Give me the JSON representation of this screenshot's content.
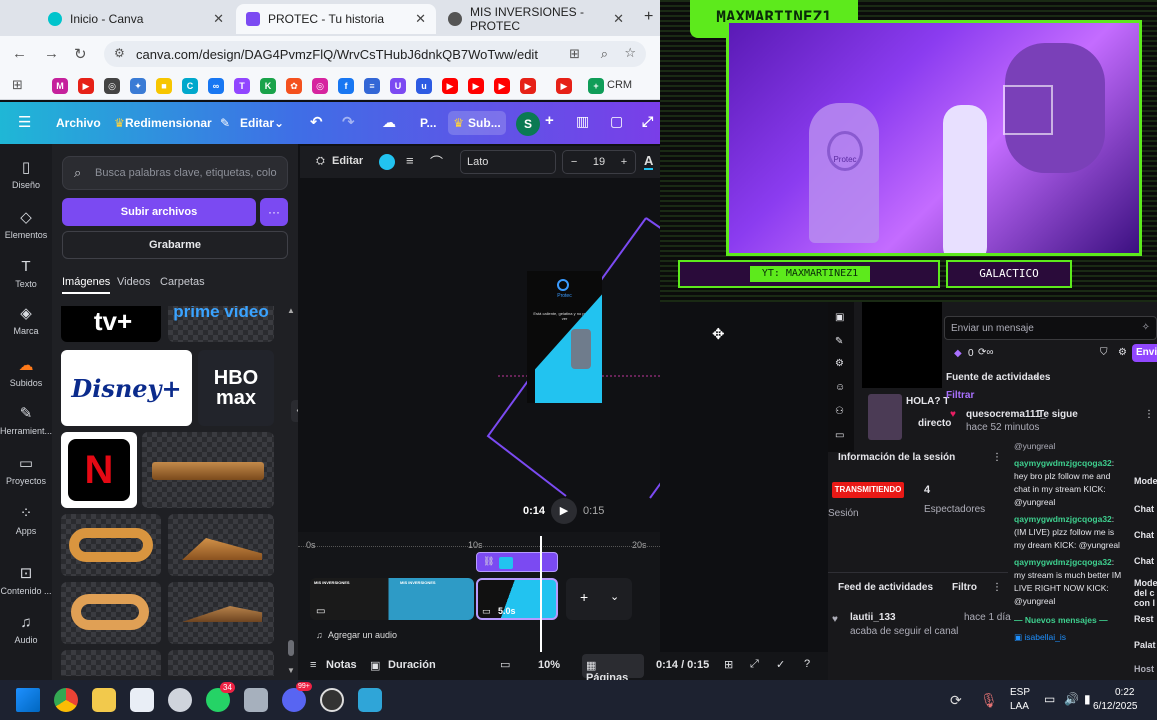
{
  "browser": {
    "tabs": [
      {
        "title": "Inicio - Canva",
        "active": false
      },
      {
        "title": "PROTEC - Tu historia",
        "active": true
      },
      {
        "title": "MIS INVERSIONES - PROTEC",
        "active": false
      }
    ],
    "new_tab": "+",
    "url": "canva.com/design/DAG4PvmzFlQ/WrvCsTHubJ6dnkQB7WoTww/edit",
    "bookmark_crm": "CRM"
  },
  "canva": {
    "header": {
      "archivo": "Archivo",
      "redimensionar": "Redimensionar",
      "editar": "Editar",
      "p": "P...",
      "sub": "Sub...",
      "avatar": "S"
    },
    "rail": [
      "Diseño",
      "Elementos",
      "Texto",
      "Marca",
      "Subidos",
      "Herramient...",
      "Proyectos",
      "Apps",
      "Contenido ...",
      "Audio"
    ],
    "panel": {
      "search_placeholder": "Busca palabras clave, etiquetas, colo",
      "upload": "Subir archivos",
      "more": "···",
      "record": "Grabarme",
      "tabs": [
        "Imágenes",
        "Videos",
        "Carpetas"
      ],
      "logos": {
        "tv": "tv+",
        "prime": "prime video",
        "disney": "Disney+",
        "hbo1": "HBO",
        "hbo2": "max",
        "netflix": "N"
      }
    },
    "toolbar": {
      "editar": "Editar",
      "font": "Lato",
      "minus": "−",
      "size": "19",
      "plus": "+",
      "a": "A"
    },
    "playback": {
      "current": "0:14",
      "total": "0:15"
    },
    "timeline": {
      "t0": "0s",
      "t10": "10s",
      "t20": "20s",
      "clip_duration": "5.0s",
      "audio": "Agregar un audio",
      "clip1": "MIS INVERSIONES",
      "clip2": "MIS INVERSIONES"
    },
    "preview": {
      "brand": "Protec",
      "text": "Está caliente, gelatina y no pueden ver"
    },
    "bottom": {
      "notas": "Notas",
      "duracion": "Duración",
      "zoom": "10%",
      "paginas": "Páginas",
      "time": "0:14 / 0:15"
    }
  },
  "stream": {
    "streamer": "MAXMARTINEZ1",
    "yt": "YT: MAXMARTINEZ1",
    "galactico": "GALACTICO",
    "mic_brand": "Protec"
  },
  "twitch": {
    "chat_placeholder": "Enviar un mensaje",
    "send": "Envi",
    "points": "0",
    "activity_title": "Fuente de actividades",
    "filter": "Filtrar",
    "follow_user": "quesocrema111_",
    "follow_text": "Te sigue",
    "follow_time": "hace 52 minutos",
    "video_title": "HOLA? T",
    "video_sub": "directo",
    "session_title": "Información de la sesión",
    "live_badge": "TRANSMITIENDO",
    "live_count": "4",
    "sesion": "Sesión",
    "espectadores": "Espectadores",
    "feed_title": "Feed de actividades",
    "feed_filter": "Filtro",
    "feed_user": "lautii_133",
    "feed_text": "acaba de seguir el canal",
    "feed_time": "hace 1 día",
    "mention_top": "@yungreal",
    "chat": [
      {
        "user": "qaymygwdmzjgcqoga32",
        "text": ": hey bro plz follow me and chat in my stream KICK: @yungreal"
      },
      {
        "user": "qaymygwdmzjgcqoga32",
        "text": ": (IM LIVE) plzz follow me is my dream KICK: @yungreal"
      },
      {
        "user": "qaymygwdmzjgcqoga32",
        "text": ": my stream is much better IM LIVE RIGHT NOW KICK: @yungreal"
      }
    ],
    "new_messages": "Nuevos mensajes",
    "last_user": "isabellai_is",
    "right_col": [
      "Mode",
      "Chat",
      "Chat",
      "Chat",
      "Mode del c con l",
      "Rest",
      "Palat",
      "Host"
    ]
  },
  "taskbar": {
    "lang1": "ESP",
    "lang2": "LAA",
    "time": "0:22",
    "date": "6/12/2025",
    "badge": "34",
    "badge2": "99+"
  },
  "colors": {
    "canva_purple": "#7b4af2",
    "twitch_purple": "#a970ff",
    "live_red": "#e91916",
    "stream_green": "#7cff2a"
  }
}
